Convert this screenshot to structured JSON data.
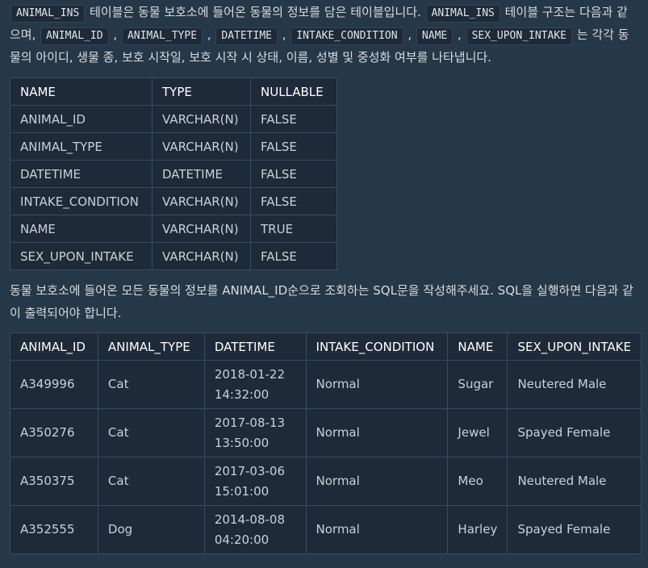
{
  "intro": {
    "code_table": "ANIMAL_INS",
    "text1": " 테이블은 동물 보호소에 들어온 동물의 정보를 담은 테이블입니다. ",
    "code_table2": "ANIMAL_INS",
    "text2": " 테이블 구조는 다음과 같으며, ",
    "columns": [
      "ANIMAL_ID",
      "ANIMAL_TYPE",
      "DATETIME",
      "INTAKE_CONDITION",
      "NAME",
      "SEX_UPON_INTAKE"
    ],
    "sep": ",",
    "text3": " 는 각각 동물의 아이디, 생물 종, 보호 시작일, 보호 시작 시 상태, 이름, 성별 및 중성화 여부를 나타냅니다."
  },
  "schema_table": {
    "headers": [
      "NAME",
      "TYPE",
      "NULLABLE"
    ],
    "rows": [
      [
        "ANIMAL_ID",
        "VARCHAR(N)",
        "FALSE"
      ],
      [
        "ANIMAL_TYPE",
        "VARCHAR(N)",
        "FALSE"
      ],
      [
        "DATETIME",
        "DATETIME",
        "FALSE"
      ],
      [
        "INTAKE_CONDITION",
        "VARCHAR(N)",
        "FALSE"
      ],
      [
        "NAME",
        "VARCHAR(N)",
        "TRUE"
      ],
      [
        "SEX_UPON_INTAKE",
        "VARCHAR(N)",
        "FALSE"
      ]
    ]
  },
  "question": "동물 보호소에 들어온 모든 동물의 정보를 ANIMAL_ID순으로 조회하는 SQL문을 작성해주세요. SQL을 실행하면 다음과 같이 출력되어야 합니다.",
  "result_table": {
    "headers": [
      "ANIMAL_ID",
      "ANIMAL_TYPE",
      "DATETIME",
      "INTAKE_CONDITION",
      "NAME",
      "SEX_UPON_INTAKE"
    ],
    "rows": [
      [
        "A349996",
        "Cat",
        "2018-01-22",
        "14:32:00",
        "Normal",
        "Sugar",
        "Neutered Male"
      ],
      [
        "A350276",
        "Cat",
        "2017-08-13",
        "13:50:00",
        "Normal",
        "Jewel",
        "Spayed Female"
      ],
      [
        "A350375",
        "Cat",
        "2017-03-06",
        "15:01:00",
        "Normal",
        "Meo",
        "Neutered Male"
      ],
      [
        "A352555",
        "Dog",
        "2014-08-08",
        "04:20:00",
        "Normal",
        "Harley",
        "Spayed Female"
      ]
    ]
  }
}
